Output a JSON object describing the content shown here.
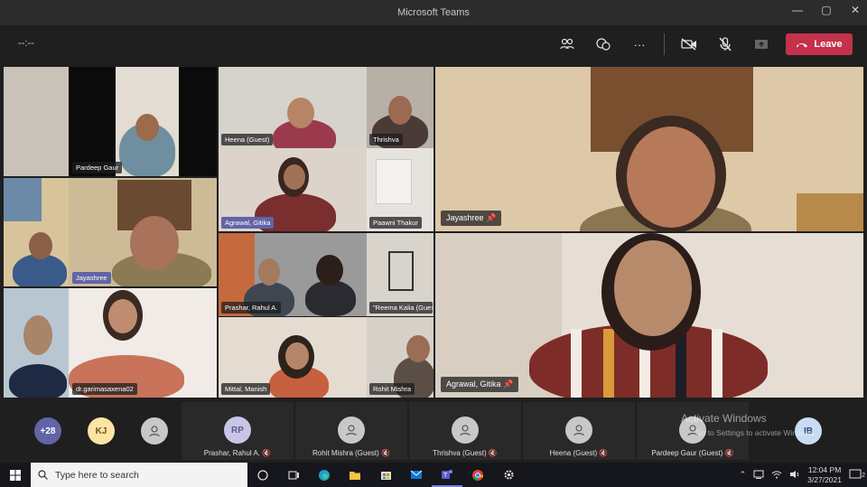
{
  "window": {
    "title": "Microsoft Teams"
  },
  "window_controls": {
    "minimize": "—",
    "maximize": "▢",
    "close": "✕"
  },
  "toolbar": {
    "timer": "--:--",
    "more": "···",
    "leave_label": "Leave"
  },
  "grid": {
    "tiles": [
      {
        "label": "Pardeep Gaur"
      },
      {
        "label": "Heena (Guest)"
      },
      {
        "label": "Thrishva"
      },
      {
        "label": "Agrawal, Gitika"
      },
      {
        "label": "Paawni Thakur"
      },
      {
        "label": "Jayashree"
      },
      {
        "label": "Prashar, Rahul A."
      },
      {
        "label": "\"Reema Kalia (Gues"
      },
      {
        "label": "dr.garimasaxena02"
      },
      {
        "label": "Mittal, Manish"
      },
      {
        "label": "Rohit Mishra"
      }
    ]
  },
  "pinned": [
    {
      "label": "Jayashree"
    },
    {
      "label": "Agrawal, Gitika"
    }
  ],
  "strip": {
    "overflow_count": "+28",
    "avatars": [
      "KJ",
      "",
      "IB"
    ],
    "participants": [
      {
        "initials": "RP",
        "name": "Prashar, Rahul A."
      },
      {
        "initials": "",
        "name": "Rohit Mishra (Guest)"
      },
      {
        "initials": "",
        "name": "Thrishva (Guest)"
      },
      {
        "initials": "",
        "name": "Heena (Guest)"
      },
      {
        "initials": "",
        "name": "Pardeep Gaur (Guest)"
      }
    ],
    "watermark_title": "Activate Windows",
    "watermark_sub": "Go to Settings to activate Windows."
  },
  "taskbar": {
    "search_placeholder": "Type here to search",
    "time": "12:04 PM",
    "date": "3/27/2021",
    "notification_count": "2"
  },
  "colors": {
    "accent": "#6264a7",
    "leave": "#c4314b",
    "titlebar": "#2d2c2c",
    "background": "#1f1f1f"
  }
}
